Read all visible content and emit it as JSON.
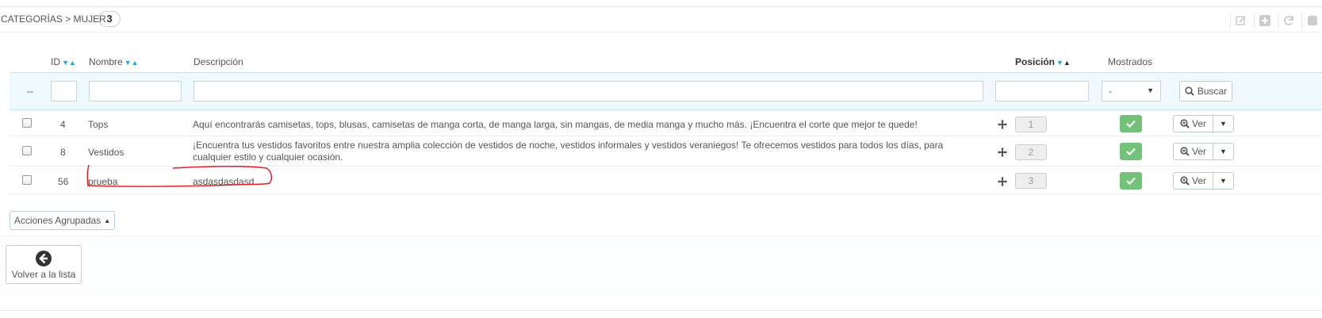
{
  "header": {
    "breadcrumb": "CATEGORÍAS > MUJER",
    "count": "3",
    "tools": [
      "edit-icon",
      "add-icon",
      "refresh-icon",
      "database-icon"
    ]
  },
  "columns": {
    "id": "ID",
    "name": "Nombre",
    "description": "Descripción",
    "position": "Posición",
    "shown": "Mostrados"
  },
  "filters": {
    "bulk_placeholder": "--",
    "shown_select": "-",
    "search_label": "Buscar"
  },
  "rows": [
    {
      "id": "4",
      "name": "Tops",
      "description": "Aquí encontrarás camisetas, tops, blusas, camisetas de manga corta, de manga larga, sin mangas, de media manga y mucho más. ¡Encuentra el corte que mejor te quede!",
      "position": "1",
      "view_label": "Ver"
    },
    {
      "id": "8",
      "name": "Vestidos",
      "description": "¡Encuentra tus vestidos favoritos entre nuestra amplia colección de vestidos de noche, vestidos informales y vestidos veraniegos! Te ofrecemos vestidos para todos los días, para cualquier estilo y cualquier ocasión.",
      "position": "2",
      "view_label": "Ver"
    },
    {
      "id": "56",
      "name": "prueba",
      "description": "asdasdasdasd",
      "position": "3",
      "view_label": "Ver"
    }
  ],
  "bulk_actions_label": "Acciones Agrupadas",
  "back_button_label": "Volver a la lista",
  "colors": {
    "accent": "#00aff0",
    "success": "#72c279",
    "annotation": "#e02020"
  }
}
